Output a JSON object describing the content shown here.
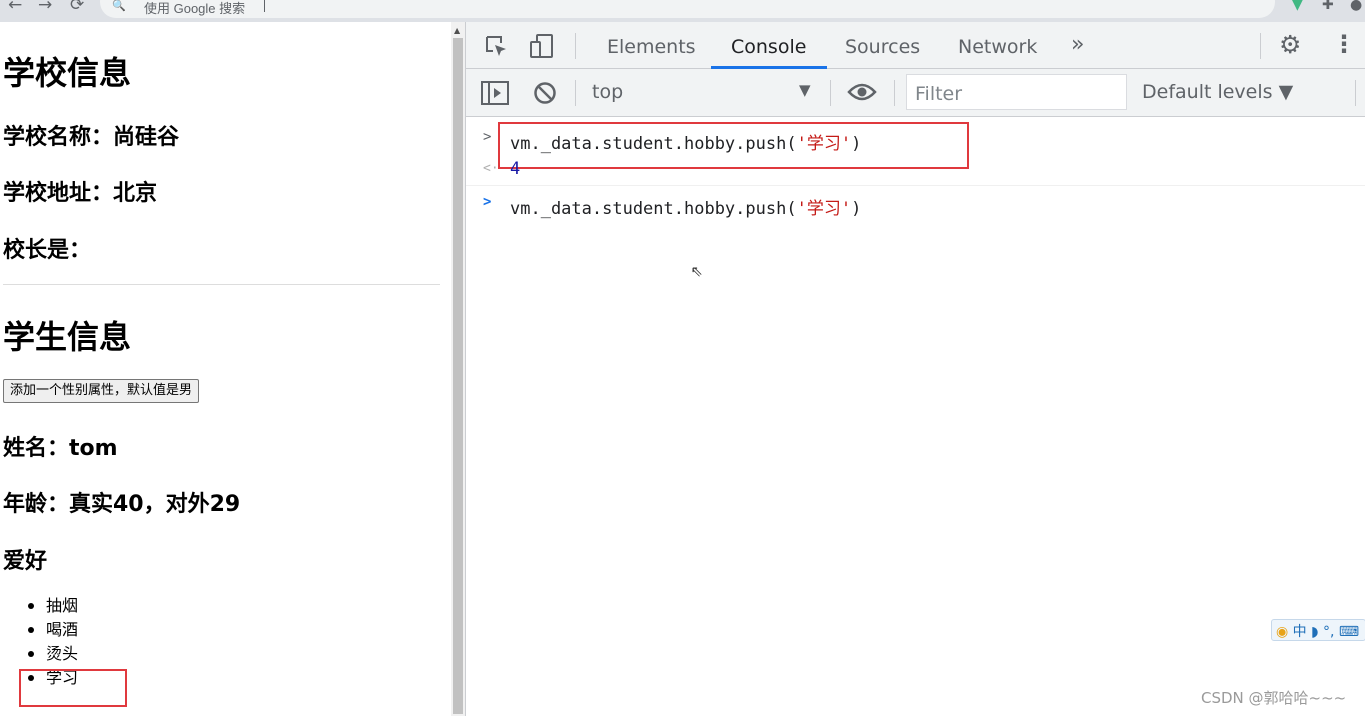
{
  "browser": {
    "omnibox_placeholder": "使用 Google 搜索",
    "nav_back": "←",
    "nav_forward": "→",
    "nav_reload": "⟳",
    "search_glyph": "🔍",
    "ext_vue_glyph": "▼",
    "ext_puzzle_glyph": "✚",
    "ext_profile_glyph": "●"
  },
  "page": {
    "school_heading": "学校信息",
    "school_name": "学校名称：尚硅谷",
    "school_address": "学校地址：北京",
    "principal": "校长是：",
    "student_heading": "学生信息",
    "add_sex_button": "添加一个性别属性，默认值是男",
    "student_name": "姓名：tom",
    "student_age": "年龄：真实40，对外29",
    "hobby_heading": "爱好",
    "hobbies": [
      "抽烟",
      "喝酒",
      "烫头",
      "学习"
    ]
  },
  "devtools": {
    "tabs": [
      "Elements",
      "Console",
      "Sources",
      "Network"
    ],
    "active_tab": "Console",
    "more_tabs_glyph": "»",
    "settings_glyph": "⚙",
    "menu_glyph": "⋮",
    "context": "top",
    "context_arrow": "▼",
    "filter_placeholder": "Filter",
    "levels": "Default levels ▼",
    "console": {
      "entries": [
        {
          "prompt": ">",
          "code_pre": "vm._data.student.hobby.push(",
          "code_str": "'学习'",
          "code_post": ")"
        },
        {
          "prompt": "<·",
          "result": "4"
        },
        {
          "prompt": ">",
          "code_pre": "vm._data.student.hobby.push(",
          "code_str": "'学习'",
          "code_post": ")"
        }
      ]
    },
    "ime_text": "中 ◗ °,",
    "watermark": "CSDN @郭哈哈~~~"
  },
  "colors": {
    "highlight_box": "#e0393e",
    "active_tab_underline": "#1a73e8",
    "string": "#c41a16",
    "number": "#1a1aa6"
  }
}
